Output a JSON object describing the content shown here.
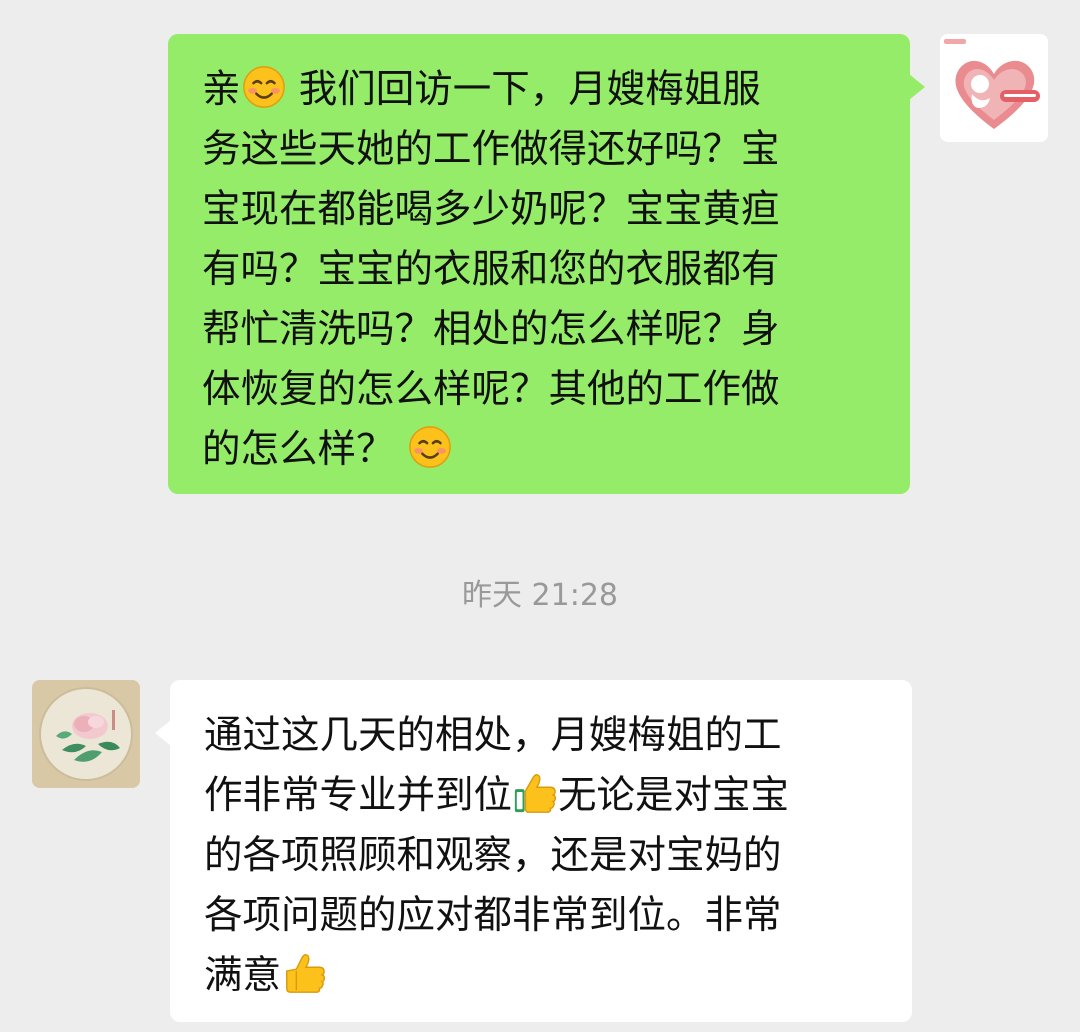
{
  "conversation": {
    "messages": [
      {
        "direction": "outgoing",
        "avatar_icon": "brand-logo-avatar-icon",
        "lines": [
          "亲",
          "我们回访一下，月嫂梅姐服",
          "务这些天她的工作做得还好吗？宝",
          "宝现在都能喝多少奶呢？宝宝黄疸",
          "有吗？宝宝的衣服和您的衣服都有",
          "帮忙清洗吗？相处的怎么样呢？身",
          "体恢复的怎么样呢？其他的工作做",
          "的怎么样？"
        ],
        "emojis": [
          "smiling-face-emoji",
          "smiling-face-emoji"
        ]
      },
      {
        "direction": "incoming",
        "avatar_icon": "peony-painting-avatar-icon",
        "lines": [
          "通过这几天的相处，月嫂梅姐的工",
          "作非常专业并到位",
          "无论是对宝宝",
          "的各项照顾和观察，还是对宝妈的",
          "各项问题的应对都非常到位。非常",
          "满意"
        ],
        "emojis": [
          "thumbs-up-emoji",
          "thumbs-up-emoji"
        ]
      }
    ],
    "timestamp": "昨天 21:28"
  },
  "colors": {
    "background": "#ededed",
    "outgoing_bubble": "#95ec69",
    "incoming_bubble": "#ffffff",
    "timestamp_text": "#999999",
    "message_text": "#111111"
  }
}
